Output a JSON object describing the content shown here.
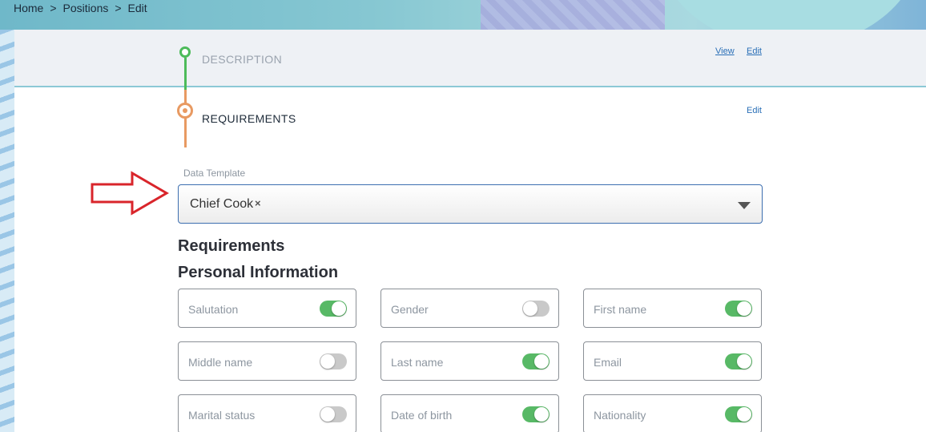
{
  "breadcrumb": {
    "items": [
      "Home",
      "Positions",
      "Edit"
    ],
    "separator": ">"
  },
  "steps": {
    "description": {
      "label": "DESCRIPTION",
      "view": "View",
      "edit": "Edit",
      "status_color": "#4cbb5a"
    },
    "requirements": {
      "label": "REQUIREMENTS",
      "edit": "Edit",
      "status_color": "#e89a62"
    }
  },
  "data_template": {
    "label": "Data Template",
    "value": "Chief Cook",
    "clear_symbol": "×"
  },
  "headings": {
    "requirements": "Requirements",
    "personal_information": "Personal Information"
  },
  "toggles": [
    {
      "label": "Salutation",
      "on": true
    },
    {
      "label": "Gender",
      "on": false
    },
    {
      "label": "First name",
      "on": true
    },
    {
      "label": "Middle name",
      "on": false
    },
    {
      "label": "Last name",
      "on": true
    },
    {
      "label": "Email",
      "on": true
    },
    {
      "label": "Marital status",
      "on": false
    },
    {
      "label": "Date of birth",
      "on": true
    },
    {
      "label": "Nationality",
      "on": true
    }
  ],
  "colors": {
    "accent_blue": "#3d6fb0",
    "toggle_on": "#58b966",
    "toggle_off": "#c9c9c9",
    "annotation_arrow": "#d9252b"
  }
}
